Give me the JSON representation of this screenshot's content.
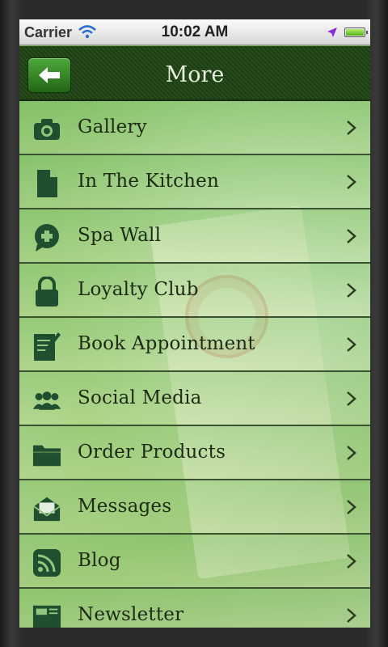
{
  "status_bar": {
    "carrier": "Carrier",
    "time": "10:02 AM"
  },
  "nav": {
    "title": "More"
  },
  "colors": {
    "nav_bg": "#1f3d15",
    "back_button": "#3c8a2d",
    "icon_dark": "#1f4f2e",
    "label": "#1d2a14"
  },
  "menu": {
    "items": [
      {
        "label": "Gallery",
        "icon": "camera-icon"
      },
      {
        "label": "In The Kitchen",
        "icon": "document-icon"
      },
      {
        "label": "Spa Wall",
        "icon": "chat-plus-icon"
      },
      {
        "label": "Loyalty Club",
        "icon": "lock-icon"
      },
      {
        "label": "Book Appointment",
        "icon": "notepad-pen-icon"
      },
      {
        "label": "Social Media",
        "icon": "people-icon"
      },
      {
        "label": "Order Products",
        "icon": "folder-icon"
      },
      {
        "label": "Messages",
        "icon": "envelope-icon"
      },
      {
        "label": "Blog",
        "icon": "rss-icon"
      },
      {
        "label": "Newsletter",
        "icon": "newspaper-icon"
      }
    ]
  }
}
